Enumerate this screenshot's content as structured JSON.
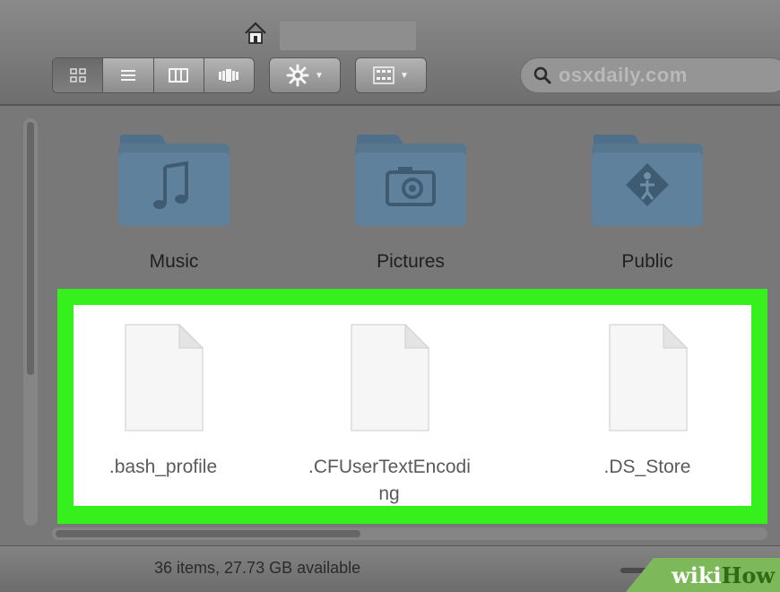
{
  "toolbar": {
    "home_icon": "home-icon",
    "view_buttons": [
      {
        "name": "icon-view",
        "icon": "grid-icon",
        "active": true
      },
      {
        "name": "list-view",
        "icon": "list-icon",
        "active": false
      },
      {
        "name": "column-view",
        "icon": "columns-icon",
        "active": false
      },
      {
        "name": "cover-flow-view",
        "icon": "coverflow-icon",
        "active": false
      }
    ],
    "action_button_icon": "gear-icon",
    "arrange_button_icon": "arrange-icon",
    "search": {
      "value": "osxdaily.com",
      "icon": "search-icon"
    }
  },
  "folders": [
    {
      "label": "Music",
      "icon": "music-folder-icon"
    },
    {
      "label": "Pictures",
      "icon": "pictures-folder-icon"
    },
    {
      "label": "Public",
      "icon": "public-folder-icon"
    }
  ],
  "hidden_files": [
    {
      "label_line1": ".bash_profile",
      "label_line2": ""
    },
    {
      "label_line1": ".CFUserTextEncodi",
      "label_line2": "ng"
    },
    {
      "label_line1": ".DS_Store",
      "label_line2": ""
    }
  ],
  "highlight_color": "#35f01c",
  "status": {
    "text": "36 items, 27.73 GB available"
  },
  "watermark": {
    "part1": "wiki",
    "part2": "How"
  }
}
